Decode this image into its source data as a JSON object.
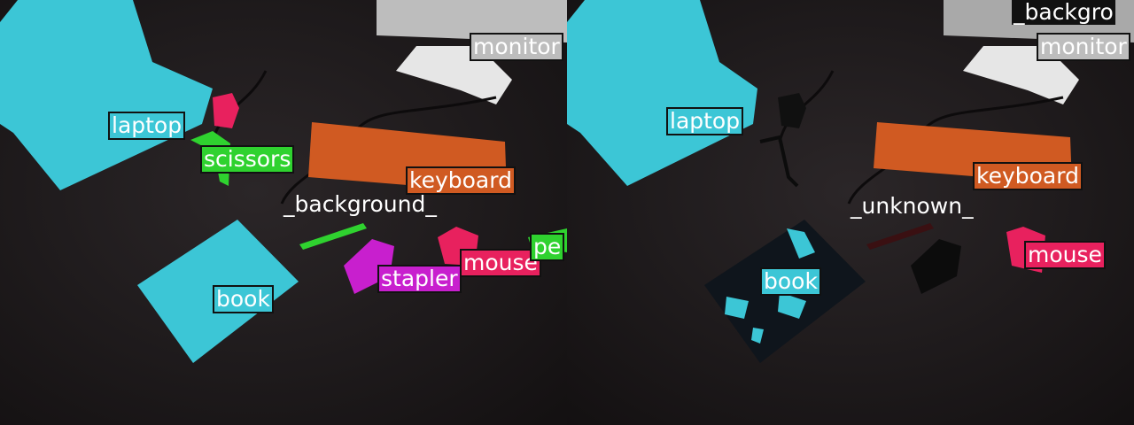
{
  "colors": {
    "laptop": "#3cc6d6",
    "book": "#3cc6d6",
    "scissors": "#2fd22f",
    "pen": "#2fd22f",
    "keyboard": "#d05a22",
    "mouse": "#e8215e",
    "stapler": "#c81fce",
    "monitor": "#bdbdbd",
    "desk": "#1f1b1d"
  },
  "left_panel": {
    "labels": {
      "laptop": "laptop",
      "scissors": "scissors",
      "keyboard": "keyboard",
      "background": "_background_",
      "book": "book",
      "stapler": "stapler",
      "mouse": "mouse",
      "monitor": "monitor",
      "pen": "pe"
    }
  },
  "right_panel": {
    "labels": {
      "laptop": "laptop",
      "keyboard": "keyboard",
      "unknown": "_unknown_",
      "book": "book",
      "mouse": "mouse",
      "monitor": "monitor",
      "background": "_backgro"
    }
  }
}
